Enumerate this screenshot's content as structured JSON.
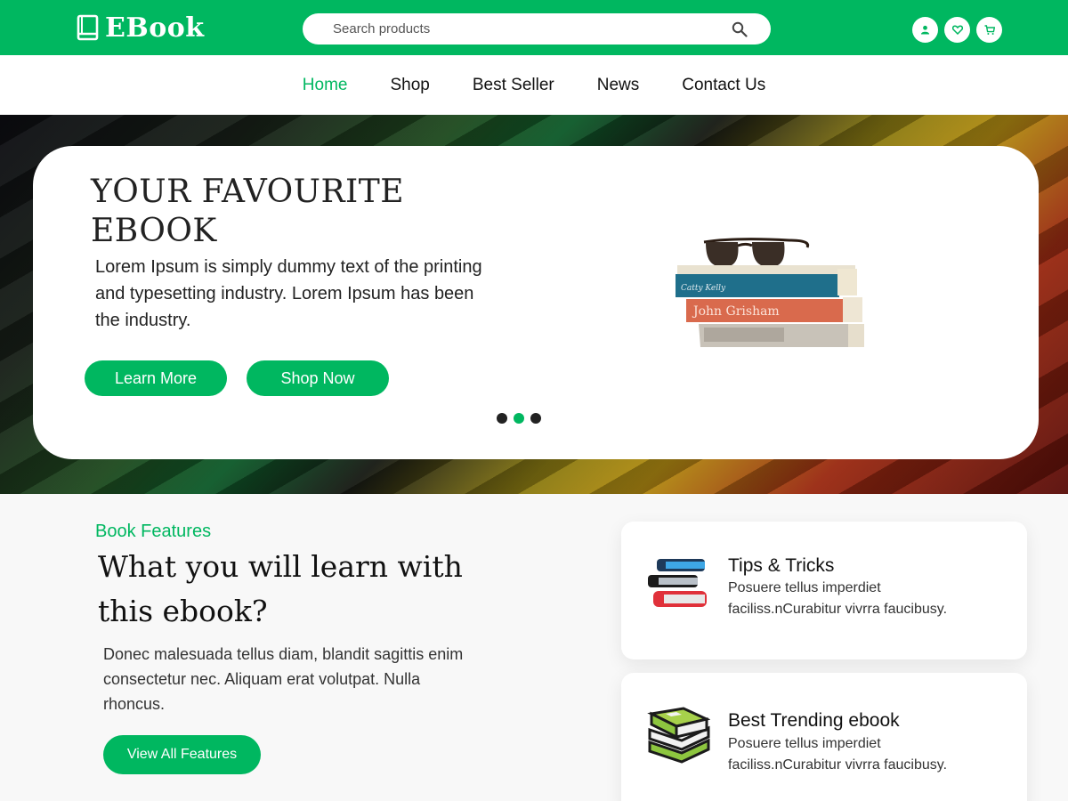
{
  "colors": {
    "brand": "#00b760",
    "text": "#111111",
    "card": "#ffffff",
    "background": "#f8f8f8"
  },
  "header": {
    "logo_text": "EBook",
    "logo_icon": "book-icon",
    "search_placeholder": "Search products",
    "search_icon": "search-icon",
    "action_icons": [
      "user-icon",
      "heart-icon",
      "cart-icon"
    ]
  },
  "nav": {
    "items": [
      {
        "label": "Home",
        "active": true
      },
      {
        "label": "Shop",
        "active": false
      },
      {
        "label": "Best Seller",
        "active": false
      },
      {
        "label": "News",
        "active": false
      },
      {
        "label": "Contact Us",
        "active": false
      }
    ]
  },
  "hero": {
    "title": "YOUR FAVOURITE EBOOK",
    "text": "Lorem Ipsum is simply dummy text of the printing and typesetting industry. Lorem Ipsum has been the industry.",
    "learn_more_label": "Learn More",
    "shop_now_label": "Shop Now",
    "slides": 3,
    "active_slide": 2,
    "image": {
      "alt": "stack-of-books-with-sunglasses",
      "spine_texts": [
        "Catty Kelly",
        "John Grisham"
      ]
    }
  },
  "features": {
    "eyebrow": "Book Features",
    "title": "What you will learn with this ebook?",
    "text": "Donec malesuada tellus diam, blandit sagittis enim consectetur nec. Aliquam erat volutpat. Nulla rhoncus.",
    "button_label": "View All Features",
    "cards": [
      {
        "title": "Tips & Tricks",
        "text": "Posuere tellus imperdiet faciliss.nCurabitur vivrra faucibusy.",
        "icon": "book-stack-icon"
      },
      {
        "title": "Best Trending ebook",
        "text": "Posuere tellus imperdiet faciliss.nCurabitur vivrra faucibusy.",
        "icon": "green-books-icon"
      }
    ]
  }
}
